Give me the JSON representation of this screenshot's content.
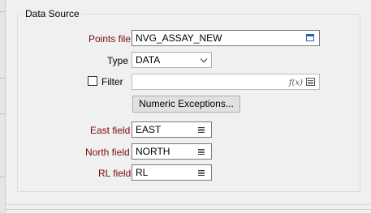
{
  "group": {
    "title": "Data Source"
  },
  "points_file": {
    "label": "Points file",
    "value": "NVG_ASSAY_NEW",
    "icon": "browse-icon"
  },
  "type": {
    "label": "Type",
    "value": "DATA",
    "icon": "chevron-down-icon"
  },
  "filter": {
    "label": "Filter",
    "checked": false,
    "value": "",
    "icons": [
      "function-icon",
      "grid-icon"
    ]
  },
  "numeric_exceptions": {
    "label": "Numeric Exceptions..."
  },
  "east_field": {
    "label": "East field",
    "value": "EAST",
    "icon": "list-icon"
  },
  "north_field": {
    "label": "North field",
    "value": "NORTH",
    "icon": "list-icon"
  },
  "rl_field": {
    "label": "RL field",
    "value": "RL",
    "icon": "list-icon"
  },
  "colors": {
    "required_label": "#7a0a0a",
    "background": "#f0f0f0"
  }
}
